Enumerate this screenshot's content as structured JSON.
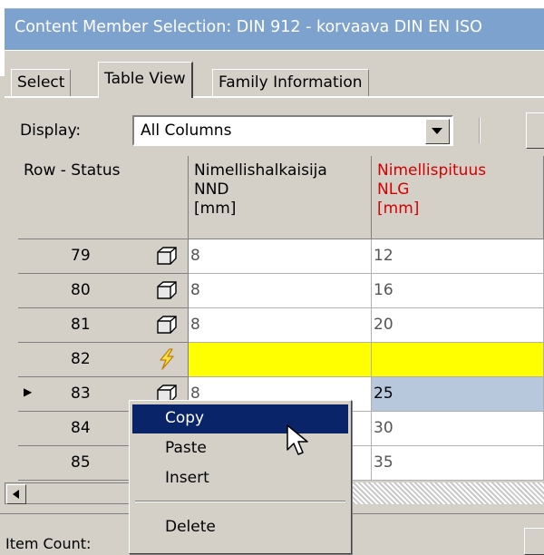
{
  "window": {
    "title": "Content Member Selection:  DIN 912  - korvaava DIN EN ISO"
  },
  "tabs": [
    {
      "label": "Select"
    },
    {
      "label": "Table View"
    },
    {
      "label": "Family Information"
    }
  ],
  "display": {
    "label": "Display:",
    "value": "All Columns"
  },
  "table": {
    "columns": [
      {
        "lines": [
          "Row - Status"
        ]
      },
      {
        "lines": [
          "Nimellishalkaisija",
          "NND",
          "[mm]"
        ],
        "color": "#000000"
      },
      {
        "lines": [
          "Nimellispituus",
          "NLG",
          "[mm]"
        ],
        "color": "#d40000"
      }
    ],
    "rows": [
      {
        "num": "79",
        "status_icon": "cube-icon",
        "nnd": "8",
        "nlg": "12"
      },
      {
        "num": "80",
        "status_icon": "cube-icon",
        "nnd": "8",
        "nlg": "16"
      },
      {
        "num": "81",
        "status_icon": "cube-icon",
        "nnd": "8",
        "nlg": "20"
      },
      {
        "num": "82",
        "status_icon": "lightning-icon",
        "nnd": "",
        "nlg": ""
      },
      {
        "num": "83",
        "status_icon": "cube-icon",
        "nnd": "8",
        "nlg": "25",
        "current": true
      },
      {
        "num": "84",
        "status_icon": "cube-icon",
        "nnd": "",
        "nlg": "30"
      },
      {
        "num": "85",
        "status_icon": "cube-icon",
        "nnd": "",
        "nlg": "35"
      }
    ]
  },
  "context_menu": {
    "items": [
      {
        "label": "Copy",
        "highlighted": true
      },
      {
        "label": "Paste"
      },
      {
        "label": "Insert"
      },
      {
        "label": "Delete"
      }
    ]
  },
  "status_bar": {
    "item_count_label": "Item Count:"
  },
  "colors": {
    "title_bar": "#7da2ce",
    "warning_row": "#ffff00",
    "menu_highlight": "#0a246a",
    "selected_cell": "#b8c8dc",
    "required_column_header": "#d40000"
  }
}
